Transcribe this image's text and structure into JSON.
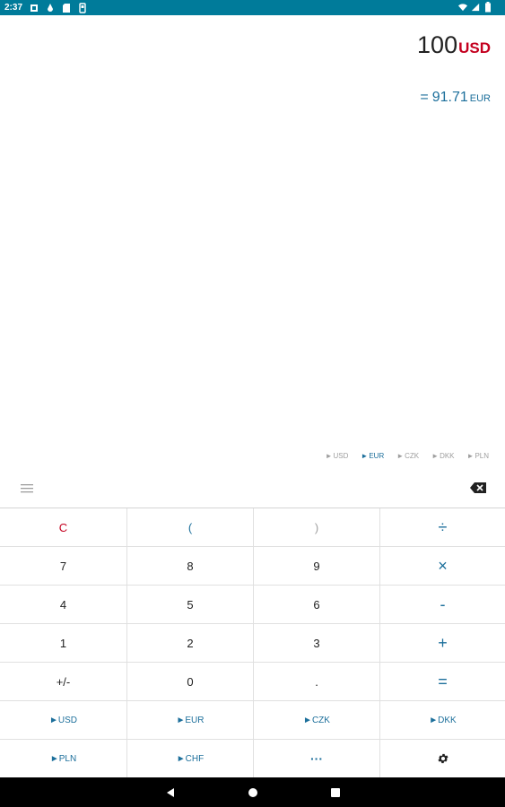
{
  "status": {
    "time": "2:37"
  },
  "display": {
    "input_value": "100",
    "input_currency": "USD",
    "result_prefix": "=",
    "result_value": "91.71",
    "result_currency": "EUR"
  },
  "quick_currencies": [
    {
      "label": "USD",
      "active": false
    },
    {
      "label": "EUR",
      "active": true
    },
    {
      "label": "CZK",
      "active": false
    },
    {
      "label": "DKK",
      "active": false
    },
    {
      "label": "PLN",
      "active": false
    }
  ],
  "keypad": {
    "clear": "C",
    "open_paren": "(",
    "close_paren": ")",
    "divide": "÷",
    "seven": "7",
    "eight": "8",
    "nine": "9",
    "multiply": "×",
    "four": "4",
    "five": "5",
    "six": "6",
    "minus": "-",
    "one": "1",
    "two": "2",
    "three": "3",
    "plus": "+",
    "plus_minus": "+/-",
    "zero": "0",
    "decimal": ".",
    "equals": "=",
    "curr_usd": "►USD",
    "curr_eur": "►EUR",
    "curr_czk": "►CZK",
    "curr_dkk": "►DKK",
    "curr_pln": "►PLN",
    "curr_chf": "►CHF",
    "more": "···"
  },
  "colors": {
    "status_bar": "#007b9a",
    "accent_blue": "#1c6f9b",
    "accent_red": "#c4001f"
  }
}
